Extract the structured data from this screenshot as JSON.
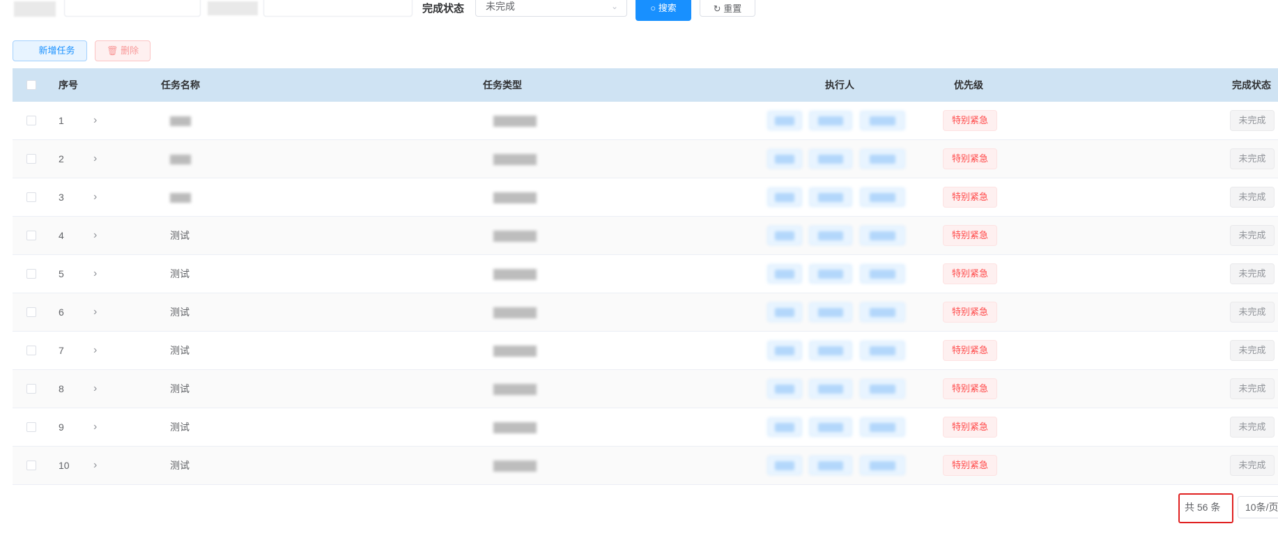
{
  "filters": {
    "status_label": "完成状态",
    "status_value": "未完成",
    "search_label": "搜索",
    "reset_label": "重置"
  },
  "actions": {
    "add_label": "新增任务",
    "delete_label": "删除"
  },
  "table": {
    "columns": [
      "序号",
      "任务名称",
      "任务类型",
      "执行人",
      "优先级",
      "完成状态"
    ],
    "rows": [
      {
        "index": "1",
        "priority": "特别紧急",
        "status": "未完成"
      },
      {
        "index": "2",
        "priority": "特别紧急",
        "status": "未完成"
      },
      {
        "index": "3",
        "priority": "特别紧急",
        "status": "未完成"
      },
      {
        "index": "4",
        "name": "测试",
        "priority": "特别紧急",
        "status": "未完成"
      },
      {
        "index": "5",
        "name": "测试",
        "priority": "特别紧急",
        "status": "未完成"
      },
      {
        "index": "6",
        "name": "测试",
        "priority": "特别紧急",
        "status": "未完成"
      },
      {
        "index": "7",
        "name": "测试",
        "priority": "特别紧急",
        "status": "未完成"
      },
      {
        "index": "8",
        "name": "测试",
        "priority": "特别紧急",
        "status": "未完成"
      },
      {
        "index": "9",
        "name": "测试",
        "priority": "特别紧急",
        "status": "未完成"
      },
      {
        "index": "10",
        "name": "测试",
        "priority": "特别紧急",
        "status": "未完成"
      }
    ]
  },
  "pagination": {
    "total": "共 56 条",
    "page_size": "10条/页"
  },
  "colors": {
    "primary": "#1890ff",
    "header_bg": "#cfe3f3",
    "danger": "#ff4949",
    "highlight_box": "#e02020"
  }
}
